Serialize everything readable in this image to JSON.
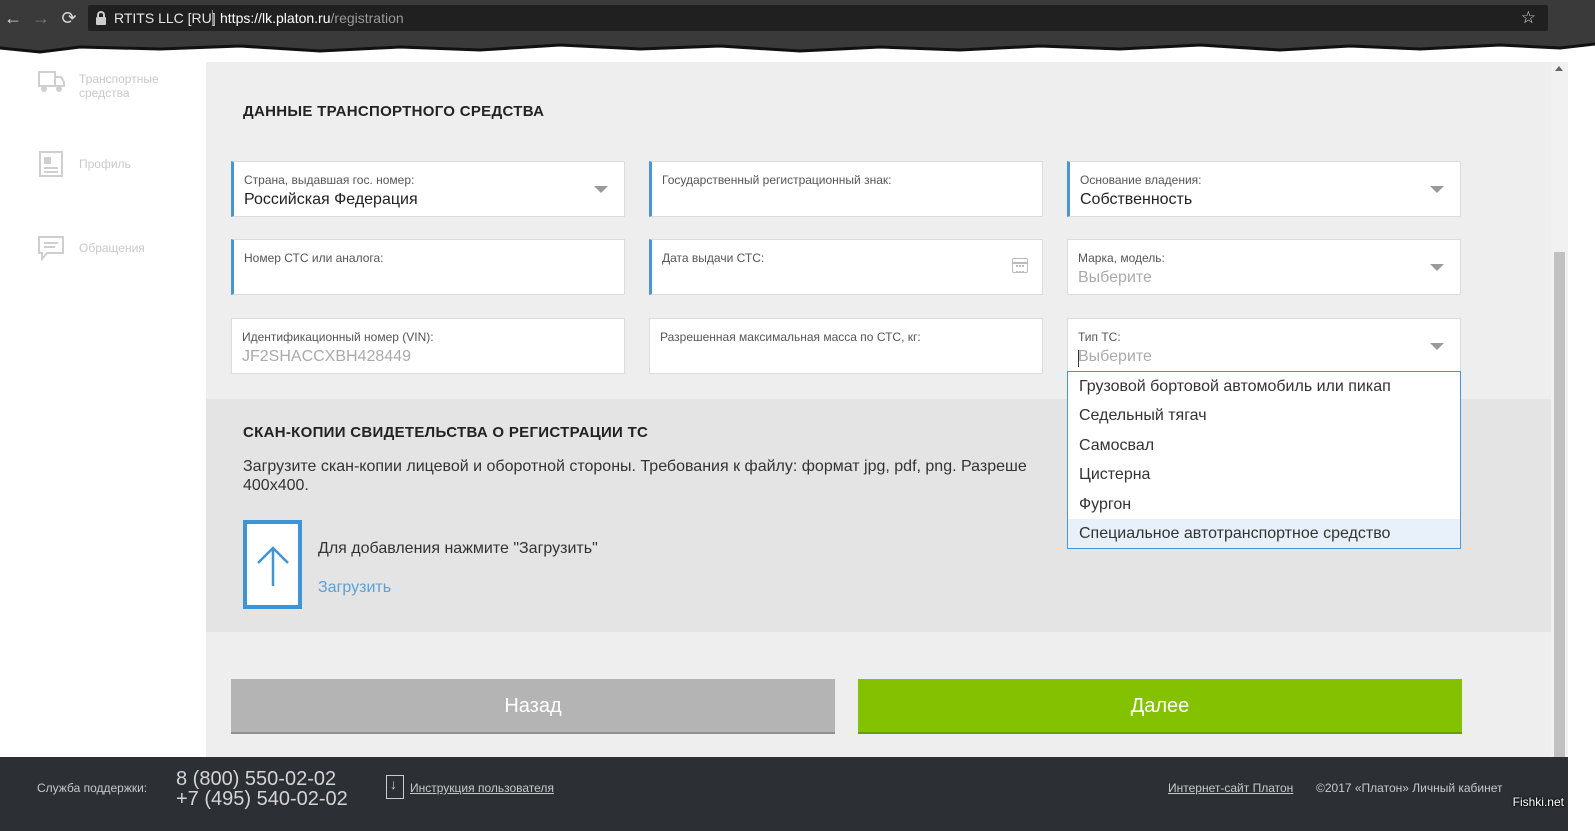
{
  "browser": {
    "cert_name": "RTITS LLC [RU]",
    "url_host": "https://lk.platon.ru",
    "url_path": "/registration"
  },
  "sidebar": {
    "items": [
      {
        "label": "Транспортные средства",
        "icon": "truck-icon"
      },
      {
        "label": "Профиль",
        "icon": "profile-icon"
      },
      {
        "label": "Обращения",
        "icon": "message-icon"
      }
    ]
  },
  "vehicle_section": {
    "title": "ДАННЫЕ ТРАНСПОРТНОГО СРЕДСТВА",
    "fields": {
      "country": {
        "label": "Страна, выдавшая гос. номер:",
        "value": "Российская Федерация"
      },
      "plate": {
        "label": "Государственный регистрационный знак:",
        "value": ""
      },
      "ownership": {
        "label": "Основание владения:",
        "value": "Собственность"
      },
      "sts_number": {
        "label": "Номер СТС или аналога:",
        "value": ""
      },
      "sts_date": {
        "label": "Дата выдачи СТС:",
        "value": ""
      },
      "make_model": {
        "label": "Марка, модель:",
        "placeholder": "Выберите"
      },
      "vin": {
        "label": "Идентификационный номер (VIN):",
        "placeholder": "JF2SHACCXBH428449"
      },
      "max_mass": {
        "label": "Разрешенная максимальная масса по СТС, кг:",
        "value": ""
      },
      "vehicle_type": {
        "label": "Тип ТС:",
        "placeholder": "Выберите"
      }
    }
  },
  "vehicle_type_dropdown": {
    "options": [
      "Грузовой бортовой автомобиль или пикап",
      "Седельный тягач",
      "Самосвал",
      "Цистерна",
      "Фургон",
      "Специальное автотранспортное средство"
    ],
    "highlighted": "Специальное автотранспортное средство"
  },
  "scan_section": {
    "title": "СКАН-КОПИИ СВИДЕТЕЛЬСТВА О РЕГИСТРАЦИИ ТС",
    "description_line1": "Загрузите скан-копии лицевой и оборотной стороны. Требования к файлу: формат jpg, pdf, png. Разреше",
    "description_line2": "400x400.",
    "upload_hint": "Для добавления нажмите \"Загрузить\"",
    "upload_link": "Загрузить"
  },
  "buttons": {
    "back": "Назад",
    "next": "Далее"
  },
  "footer": {
    "support_label": "Служба поддержки:",
    "phone1": "8 (800) 550-02-02",
    "phone2": "+7 (495) 540-02-02",
    "manual_link": "Инструкция пользователя",
    "site_link": "Интернет-сайт Платон",
    "copyright": "©2017 «Платон» Личный кабинет"
  },
  "watermark": "Fishki.net",
  "colors": {
    "accent_blue": "#4a95d3",
    "next_green": "#84c100",
    "back_grey": "#b4b4b4",
    "footer_bg": "#2c2f34"
  }
}
